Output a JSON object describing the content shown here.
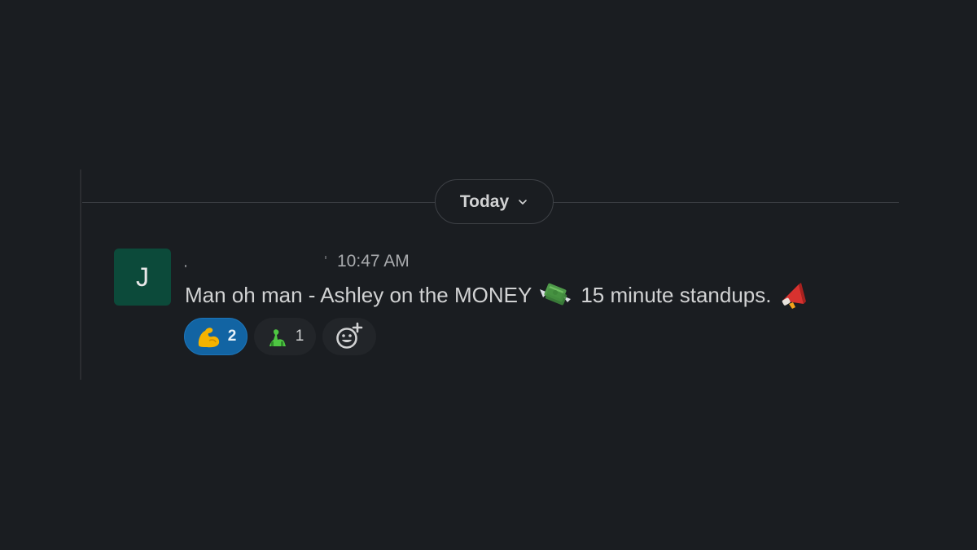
{
  "divider": {
    "date_label": "Today"
  },
  "message": {
    "avatar_initial": "J",
    "timestamp": "10:47 AM",
    "text_part1": "Man oh man - Ashley on the MONEY",
    "text_part2": "15 minute standups.",
    "emojis": [
      "money-with-wings-icon",
      "loudspeaker-icon"
    ]
  },
  "reactions": [
    {
      "emoji": "flexed-biceps-icon",
      "count": "2",
      "selected": true
    },
    {
      "emoji": "zombie-icon",
      "count": "1",
      "selected": false
    }
  ],
  "colors": {
    "background": "#1a1d21",
    "avatar": "#0c4a3a",
    "reaction_active": "#1264a3",
    "reaction_inactive": "#222529",
    "text": "#d1d2d3",
    "muted_text": "#a9abae"
  }
}
